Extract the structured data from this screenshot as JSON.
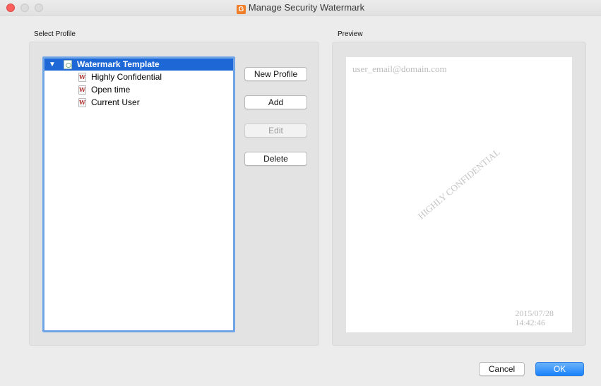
{
  "window": {
    "title": "Manage Security Watermark",
    "app_icon_glyph": "G",
    "app_icon_color": "#f07d29"
  },
  "profile_section": {
    "label": "Select Profile",
    "tree": {
      "root": "Watermark Template",
      "items": [
        "Highly Confidential",
        "Open time",
        "Current User"
      ]
    },
    "buttons": {
      "new_profile": "New Profile",
      "add": "Add",
      "edit": "Edit",
      "delete": "Delete"
    }
  },
  "preview_section": {
    "label": "Preview",
    "email": "user_email@domain.com",
    "diagonal_text": "HIGHLY CONFIDENTIAL",
    "date": "2015/07/28",
    "time": "14:42:46"
  },
  "footer": {
    "cancel": "Cancel",
    "ok": "OK"
  },
  "colors": {
    "selection": "#1e67d6",
    "focus_ring": "#6fa4e6",
    "default_button": "#1a82fb",
    "close_button": "#fc605c"
  }
}
